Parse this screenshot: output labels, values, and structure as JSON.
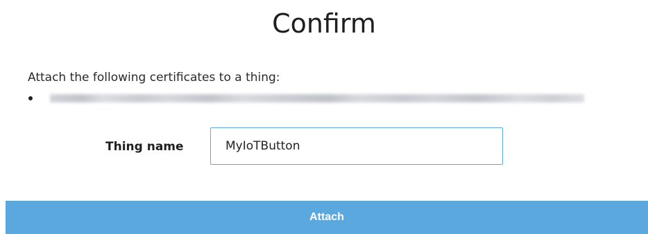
{
  "dialog": {
    "title": "Confirm",
    "intro_text": "Attach the following certificates to a thing:"
  },
  "form": {
    "thing_name_label": "Thing name",
    "thing_name_value": "MyIoTButton"
  },
  "actions": {
    "attach_label": "Attach"
  },
  "colors": {
    "accent": "#5ba8df",
    "input_border": "#5aa9e6"
  }
}
